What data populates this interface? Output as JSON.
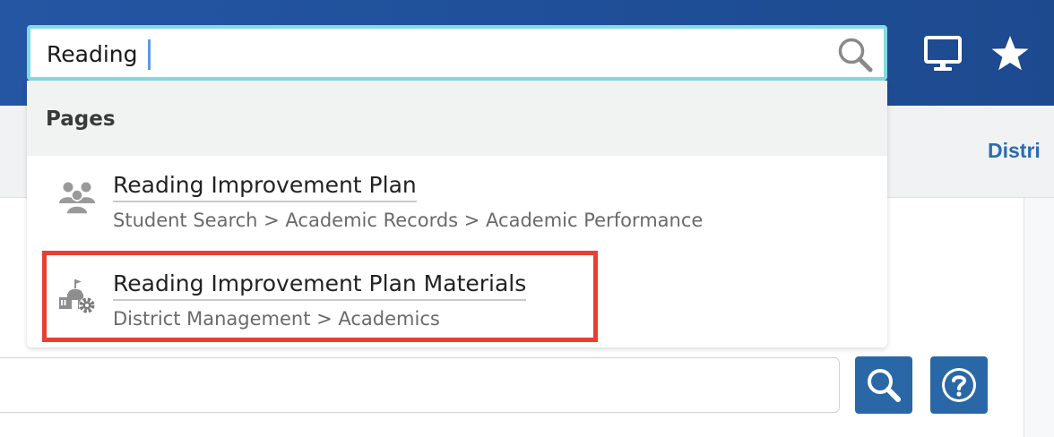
{
  "search": {
    "value": "Reading",
    "icon": "search-icon"
  },
  "header": {
    "desktop_icon": "desktop-icon",
    "star_icon": "star-icon"
  },
  "background": {
    "district_link": "Distri"
  },
  "dropdown": {
    "section_label": "Pages",
    "items": [
      {
        "title": "Reading Improvement Plan",
        "path": "Student Search > Academic Records > Academic Performance",
        "icon": "students-group-icon"
      },
      {
        "title": "Reading Improvement Plan Materials",
        "path": "District Management > Academics",
        "icon": "district-settings-icon",
        "highlighted": true
      }
    ]
  },
  "toolbar": {
    "search_button_icon": "search-icon",
    "help_button_icon": "help-icon"
  },
  "colors": {
    "header_blue": "#2456a3",
    "search_border": "#82dbe0",
    "highlight": "#e8402e",
    "button_blue": "#2a67a6",
    "link_blue": "#2b6cb0"
  }
}
